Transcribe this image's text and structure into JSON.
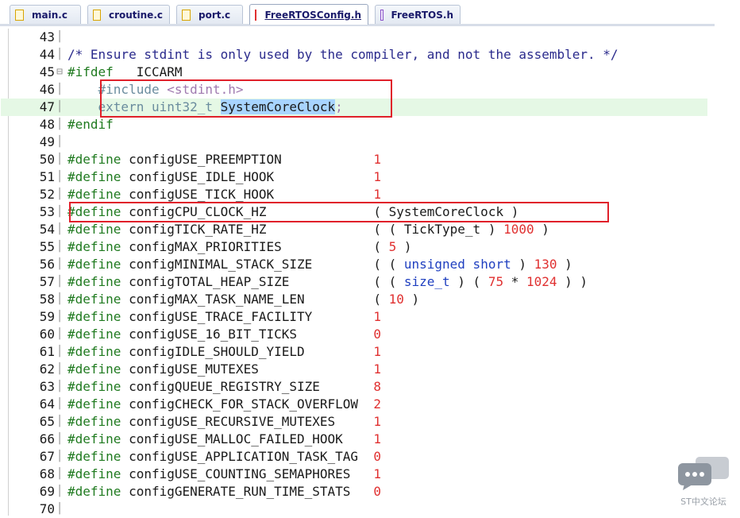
{
  "tabs": [
    {
      "label": "main.c",
      "kind": "c-src",
      "active": false
    },
    {
      "label": "croutine.c",
      "kind": "c-src",
      "active": false
    },
    {
      "label": "port.c",
      "kind": "c-src",
      "active": false
    },
    {
      "label": "FreeRTOSConfig.h",
      "kind": "h-act",
      "active": true
    },
    {
      "label": "FreeRTOS.h",
      "kind": "h-src",
      "active": false
    }
  ],
  "lines": [
    {
      "n": "43",
      "code": ""
    },
    {
      "n": "44",
      "code": "/* Ensure stdint is only used by the compiler, and not the assembler. */"
    },
    {
      "n": "45",
      "code": "#ifdef   ICCARM"
    },
    {
      "n": "46",
      "code": "    #include <stdint.h>"
    },
    {
      "n": "47",
      "code": "    extern uint32_t SystemCoreClock;"
    },
    {
      "n": "48",
      "code": "#endif"
    },
    {
      "n": "49",
      "code": ""
    },
    {
      "n": "50",
      "name": "configUSE_PREEMPTION",
      "value": "1"
    },
    {
      "n": "51",
      "name": "configUSE_IDLE_HOOK",
      "value": "1"
    },
    {
      "n": "52",
      "name": "configUSE_TICK_HOOK",
      "value": "1"
    },
    {
      "n": "53",
      "name": "configCPU_CLOCK_HZ",
      "value": "( SystemCoreClock )"
    },
    {
      "n": "54",
      "name": "configTICK_RATE_HZ",
      "value": "( ( TickType_t ) 1000 )"
    },
    {
      "n": "55",
      "name": "configMAX_PRIORITIES",
      "value": "( 5 )"
    },
    {
      "n": "56",
      "name": "configMINIMAL_STACK_SIZE",
      "value": "( ( unsigned short ) 130 )"
    },
    {
      "n": "57",
      "name": "configTOTAL_HEAP_SIZE",
      "value": "( ( size_t ) ( 75 * 1024 ) )"
    },
    {
      "n": "58",
      "name": "configMAX_TASK_NAME_LEN",
      "value": "( 10 )"
    },
    {
      "n": "59",
      "name": "configUSE_TRACE_FACILITY",
      "value": "1"
    },
    {
      "n": "60",
      "name": "configUSE_16_BIT_TICKS",
      "value": "0"
    },
    {
      "n": "61",
      "name": "configIDLE_SHOULD_YIELD",
      "value": "1"
    },
    {
      "n": "62",
      "name": "configUSE_MUTEXES",
      "value": "1"
    },
    {
      "n": "63",
      "name": "configQUEUE_REGISTRY_SIZE",
      "value": "8"
    },
    {
      "n": "64",
      "name": "configCHECK_FOR_STACK_OVERFLOW",
      "value": "2"
    },
    {
      "n": "65",
      "name": "configUSE_RECURSIVE_MUTEXES",
      "value": "1"
    },
    {
      "n": "66",
      "name": "configUSE_MALLOC_FAILED_HOOK",
      "value": "1"
    },
    {
      "n": "67",
      "name": "configUSE_APPLICATION_TASK_TAG",
      "value": "0"
    },
    {
      "n": "68",
      "name": "configUSE_COUNTING_SEMAPHORES",
      "value": "1"
    },
    {
      "n": "69",
      "name": "configGENERATE_RUN_TIME_STATS",
      "value": "0"
    },
    {
      "n": "70",
      "code": ""
    }
  ],
  "define_keyword": "#define",
  "watermark": "ST中文论坛",
  "colors": {
    "highlight_box": "#e0202a",
    "number": "#e03030",
    "directive": "#1f7a1f"
  }
}
